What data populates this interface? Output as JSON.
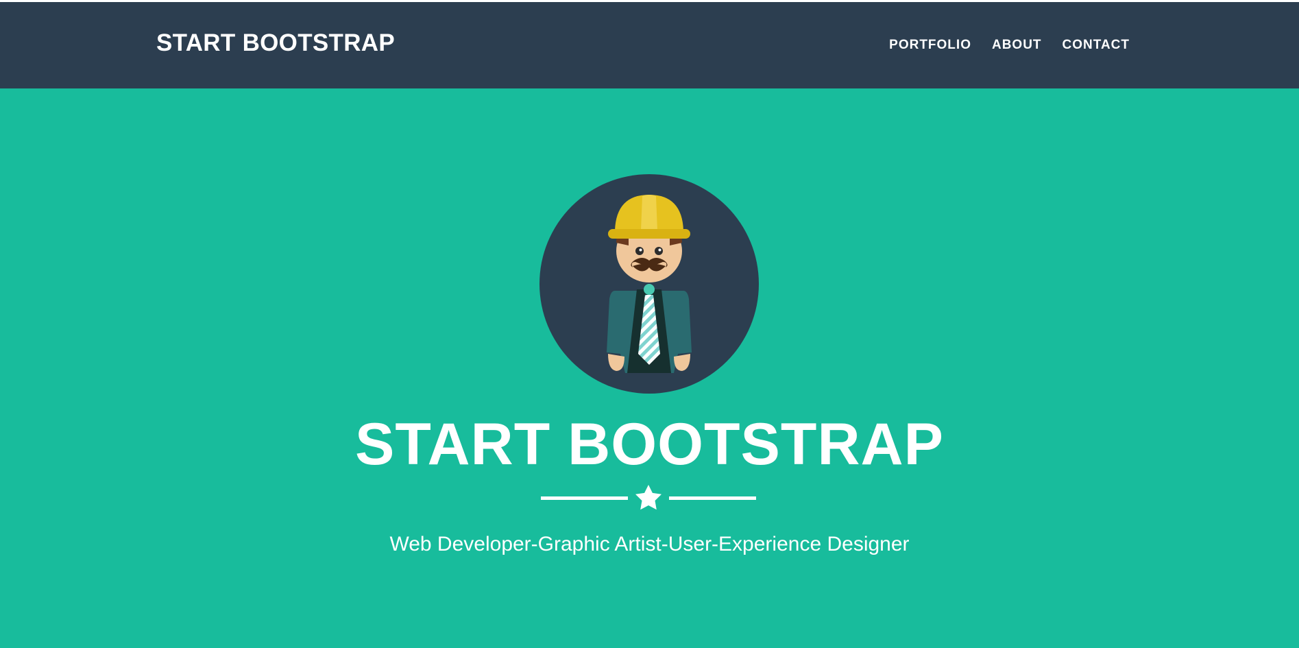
{
  "navbar": {
    "brand": "START BOOTSTRAP",
    "links": [
      {
        "label": "PORTFOLIO"
      },
      {
        "label": "ABOUT"
      },
      {
        "label": "CONTACT"
      }
    ]
  },
  "hero": {
    "avatar_icon": "profile-avatar-icon",
    "title": "START BOOTSTRAP",
    "divider_icon": "star-icon",
    "subtitle": "Web Developer-Graphic Artist-User-Experience Designer"
  },
  "colors": {
    "navbar_bg": "#2c3e50",
    "hero_bg": "#18bc9c",
    "text": "#ffffff"
  }
}
